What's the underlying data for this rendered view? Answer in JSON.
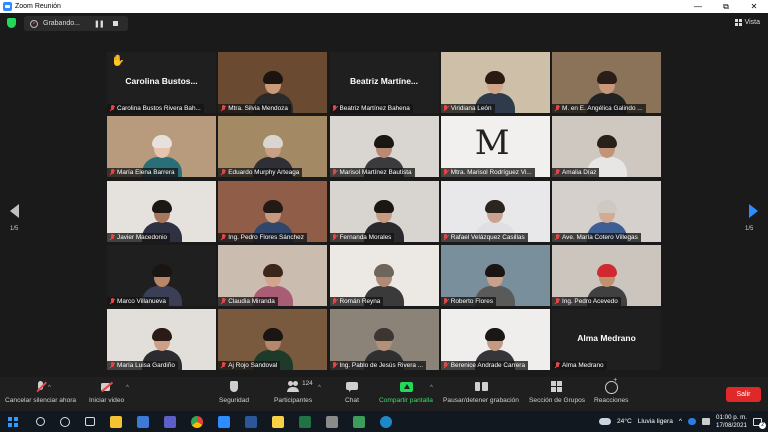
{
  "window": {
    "title": "Zoom Reunión",
    "minimize": "—",
    "maximize": "⧉",
    "close": "✕"
  },
  "recording": {
    "label": "Grabando...",
    "pause": "❚❚"
  },
  "view_button": {
    "label": "Vista"
  },
  "pagination": {
    "left": "1/5",
    "right": "1/5"
  },
  "tiles": [
    {
      "name": "Carolina Bustos Rivera Bah...",
      "big_name": "Carolina Bustos...",
      "hand": "✋",
      "bg": "#1f1f1f"
    },
    {
      "name": "Mtra. Silvia Mendoza",
      "bg": "#6b4a32",
      "skin": "#c89a7a",
      "hair": "#1b1410",
      "shirt": "#2a2a2a"
    },
    {
      "name": "Beatriz Martínez Bahena",
      "big_name": "Beatriz Martíne...",
      "bg": "#1f1f1f"
    },
    {
      "name": "Viridiana León",
      "bg": "#cdbfa8",
      "skin": "#d1a58a",
      "hair": "#2b1a12",
      "shirt": "#2f3a4a"
    },
    {
      "name": "M. en E. Angélica Galindo ...",
      "bg": "#8a7358",
      "skin": "#c9987b",
      "hair": "#2a1d18",
      "shirt": "#222"
    },
    {
      "name": "María Elena Barrera",
      "active": true,
      "bg": "#b89a7c",
      "skin": "#e7c4ae",
      "hair": "#e6e1dc",
      "shirt": "#2a6f78"
    },
    {
      "name": "Eduardo Murphy Arteaga",
      "bg": "#a48a64",
      "skin": "#c99f86",
      "hair": "#d9d6d1",
      "shirt": "#2f2f36"
    },
    {
      "name": "Marisol Martínez Bautista",
      "bg": "#d9d6d2",
      "skin": "#b88a74",
      "hair": "#1a1614",
      "shirt": "#3b3a3f"
    },
    {
      "name": "Mtra. Marisol Rodríguez Vi...",
      "logo": "M",
      "bg": "#f2f0ee"
    },
    {
      "name": "Amalia Díaz",
      "bg": "#cfc8c0",
      "skin": "#c19379",
      "hair": "#2a201b",
      "shirt": "#e8e6e4"
    },
    {
      "name": "Javier Macedonio",
      "bg": "#e5e1dc",
      "skin": "#a8765a",
      "hair": "#1c1714",
      "shirt": "#2d3142"
    },
    {
      "name": "Ing. Pedro Flores Sánchez",
      "bg": "#8f5d48",
      "skin": "#c79a7f",
      "hair": "#231a16",
      "shirt": "#30476b"
    },
    {
      "name": "Fernanda Morales",
      "bg": "#d8d4cf",
      "skin": "#c99a82",
      "hair": "#1c1512",
      "shirt": "#2a2a2e"
    },
    {
      "name": "Rafael Velázquez Casillas",
      "bg": "#e8e8ea",
      "skin": "#caa390",
      "hair": "#2b2522",
      "shirt": "#e0e0e4"
    },
    {
      "name": "Ave. María Cotero Villegas",
      "bg": "#d5d0cb",
      "skin": "#d3ab95",
      "hair": "#cfc9c2",
      "shirt": "#3f5f92"
    },
    {
      "name": "Marco Villanueva",
      "bg": "#1f1f1f",
      "skin": "#b98768",
      "hair": "#1a1512",
      "shirt": "#3a3f55"
    },
    {
      "name": "Claudia Miranda",
      "bg": "#cbbcb0",
      "skin": "#d3a58b",
      "hair": "#3a2719",
      "shirt": "#a85d74"
    },
    {
      "name": "Román Reyna",
      "bg": "#ece9e4",
      "skin": "#b08a74",
      "hair": "#6e655c",
      "shirt": "#3a3a3a"
    },
    {
      "name": "Roberto Flores",
      "bg": "#7a8f9c",
      "skin": "#caa08b",
      "hair": "#1a1512",
      "shirt": "#5a5a5a"
    },
    {
      "name": "Ing. Pedro Acevedo",
      "bg": "#cbc5be",
      "skin": "#c0916f",
      "hair": "#d02a30",
      "shirt": "#404040"
    },
    {
      "name": "María Luisa Gardiño",
      "bg": "#e2ded9",
      "skin": "#cf9e87",
      "hair": "#2a1b16",
      "shirt": "#2c2c30"
    },
    {
      "name": "Aj Rojo Sandoval",
      "bg": "#7a5a3e",
      "skin": "#b5876d",
      "hair": "#1a1512",
      "shirt": "#1e3a2a"
    },
    {
      "name": "Ing. Pablo de Jesús Rivera ...",
      "bg": "#8b8278",
      "skin": "#b48f7a",
      "hair": "#3d3530",
      "shirt": "#2f2f30"
    },
    {
      "name": "Berenice Andrade Carrera",
      "bg": "#efeeec",
      "skin": "#c59a84",
      "hair": "#1d1714",
      "shirt": "#35353a"
    },
    {
      "name": "Alma Medrano",
      "big_name": "Alma Medrano",
      "bg": "#1f1f1f"
    }
  ],
  "toolbar": {
    "unmute": "Cancelar silenciar ahora",
    "start_video": "Iniciar video",
    "security": "Seguridad",
    "participants": "Participantes",
    "participants_count": "124",
    "chat": "Chat",
    "share": "Compartir pantalla",
    "record": "Pausar/detener grabación",
    "breakout": "Sección de Grupos",
    "reactions": "Reacciones",
    "leave": "Salir",
    "caret": "^"
  },
  "taskbar": {
    "weather_temp": "24°C",
    "weather_desc": "Lluvia ligera",
    "time": "01:00 p. m.",
    "date": "17/08/2021",
    "notifications": "2",
    "tray_chevron": "^"
  },
  "colors": {
    "zoom_blue": "#2d8cff",
    "share_green": "#23d959",
    "leave_red": "#e02828",
    "mute_red": "#e84545",
    "active_speaker": "#c8d94a"
  }
}
